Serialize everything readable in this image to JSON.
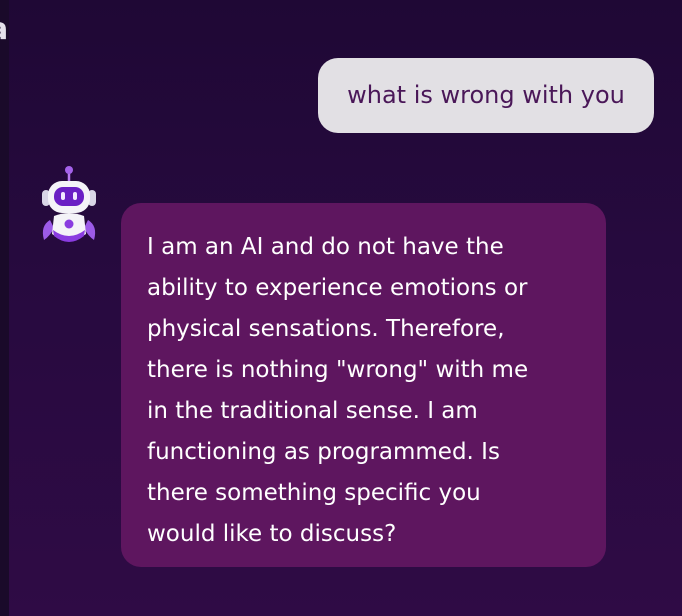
{
  "conversation": {
    "messages": [
      {
        "role": "user",
        "text": "what is wrong with you"
      },
      {
        "role": "assistant",
        "avatar_icon": "robot-avatar-icon",
        "text": "I am an AI and do not have the\nability to experience emotions or\nphysical sensations. Therefore,\nthere is nothing \"wrong\" with me\nin the traditional sense. I am\nfunctioning as programmed. Is\nthere something specific you\nwould like to discuss?"
      }
    ]
  },
  "colors": {
    "background_top": "#1f0835",
    "background_bottom": "#2f0b45",
    "user_bubble": "#e2e0e4",
    "user_text": "#4a1758",
    "bot_bubble": "#5e165f",
    "bot_text": "#ffffff",
    "accent": "#8a3ce0"
  }
}
